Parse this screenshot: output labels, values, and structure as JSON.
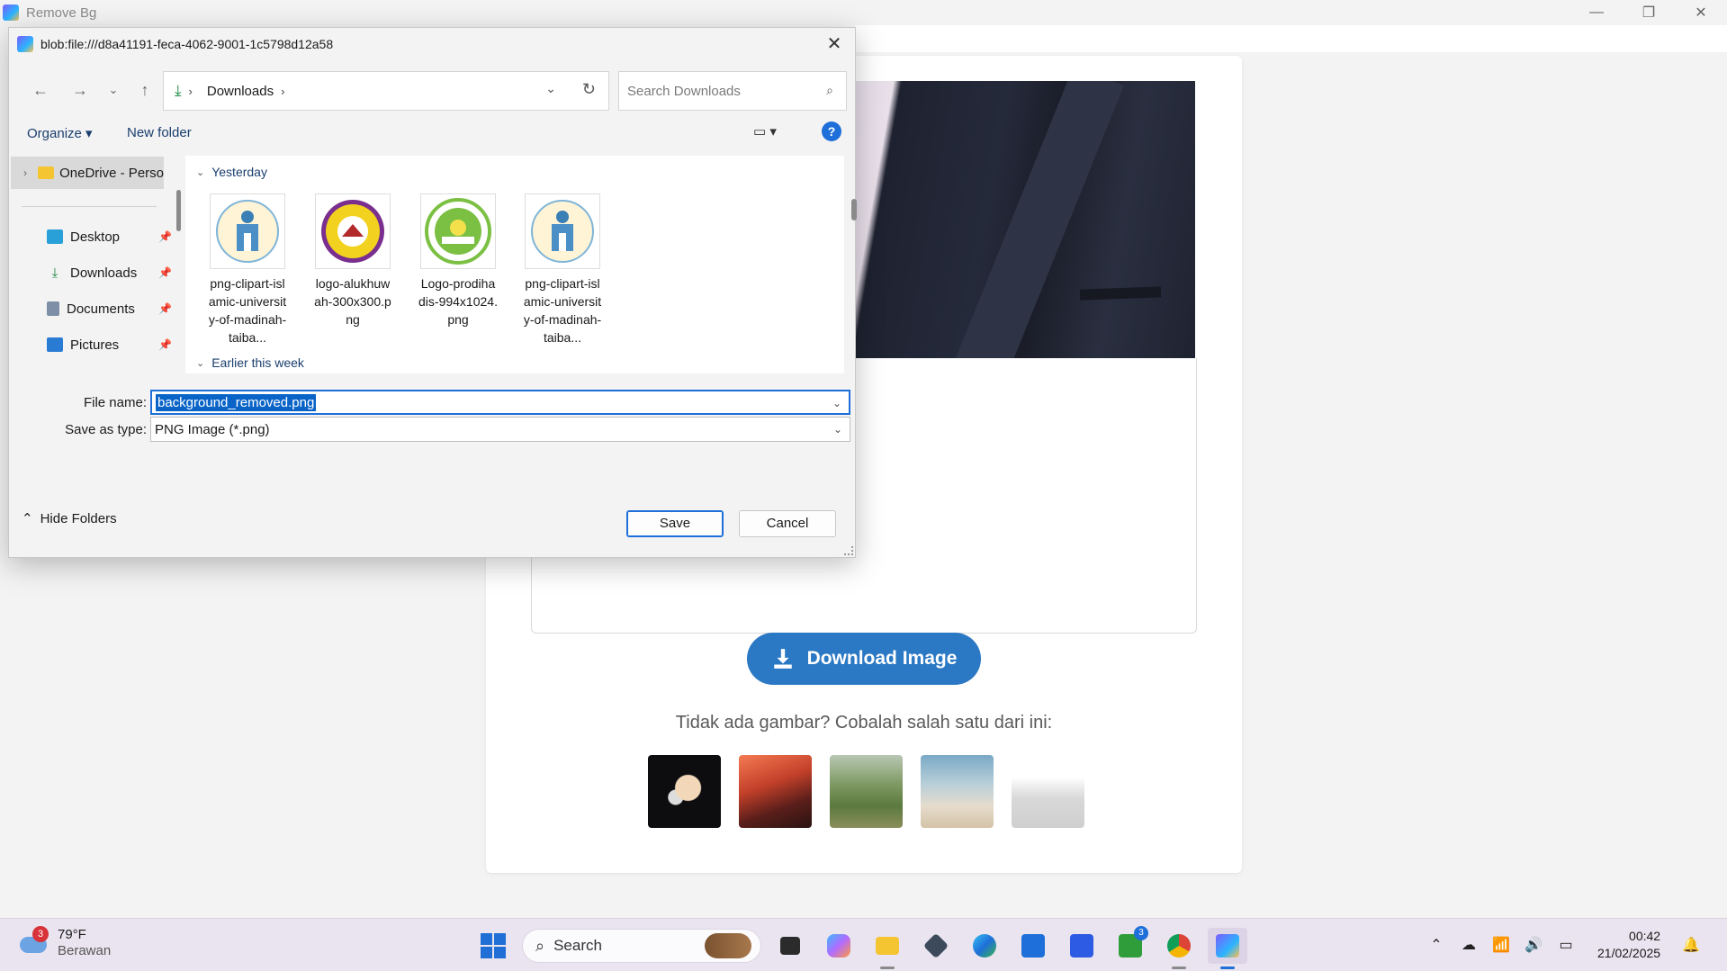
{
  "app": {
    "title": "Remove Bg",
    "download_button": "Download Image",
    "try_text": "Tidak ada gambar? Cobalah salah satu dari ini:",
    "samples": [
      "sample-planet",
      "sample-canyon",
      "sample-valley",
      "sample-beach",
      "sample-person"
    ]
  },
  "dialog": {
    "title": "blob:file:///d8a41191-feca-4062-9001-1c5798d12a58",
    "address": {
      "location": "Downloads"
    },
    "search_placeholder": "Search Downloads",
    "toolbar": {
      "organize": "Organize ▾",
      "new_folder": "New folder",
      "help": "?"
    },
    "nav_pane": {
      "onedrive": "OneDrive - Perso",
      "items": [
        "Desktop",
        "Downloads",
        "Documents",
        "Pictures"
      ]
    },
    "groups": {
      "yesterday": "Yesterday",
      "earlier": "Earlier this week"
    },
    "files": [
      {
        "name": "png-clipart-islamic-university-of-madinah-taiba...",
        "icon": "university-emblem"
      },
      {
        "name": "logo-alukhuwah-300x300.png",
        "icon": "yellow-circle-emblem"
      },
      {
        "name": "Logo-prodihadis-994x1024.png",
        "icon": "green-circle-emblem"
      },
      {
        "name": "png-clipart-islamic-university-of-madinah-taiba...",
        "icon": "university-emblem"
      }
    ],
    "file_name_label": "File name:",
    "file_name_value": "background_removed.png",
    "save_type_label": "Save as type:",
    "save_type_value": "PNG Image (*.png)",
    "hide_folders": "Hide Folders",
    "save_button": "Save",
    "cancel_button": "Cancel"
  },
  "taskbar": {
    "weather_temp": "79°F",
    "weather_cond": "Berawan",
    "weather_badge": "3",
    "search_label": "Search",
    "xbox_badge": "3",
    "time": "00:42",
    "date": "21/02/2025"
  },
  "colors": {
    "accent": "#1e6fd9",
    "download_button": "#2b78c4"
  }
}
